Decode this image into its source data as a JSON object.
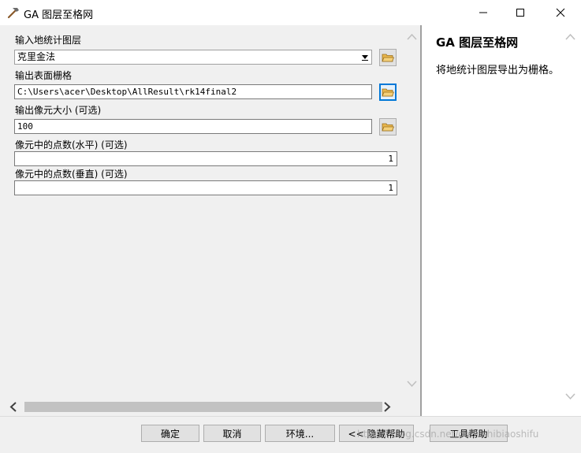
{
  "window": {
    "title": "GA 图层至格网"
  },
  "form": {
    "input_layer": {
      "label": "输入地统计图层",
      "value": "克里金法"
    },
    "output_raster": {
      "label": "输出表面栅格",
      "value": "C:\\Users\\acer\\Desktop\\AllResult\\rk14final2"
    },
    "cell_size": {
      "label": "输出像元大小 (可选)",
      "value": "100"
    },
    "points_horizontal": {
      "label": "像元中的点数(水平) (可选)",
      "value": "1"
    },
    "points_vertical": {
      "label": "像元中的点数(垂直) (可选)",
      "value": "1"
    }
  },
  "help": {
    "title": "GA 图层至格网",
    "text": "将地统计图层导出为栅格。"
  },
  "buttons": {
    "ok": "确定",
    "cancel": "取消",
    "environments": "环境...",
    "hide_help": "<< 隐藏帮助",
    "tool_help": "工具帮助"
  },
  "watermark": "https://blog.csdn.net/dabushibiaoshifu",
  "colors": {
    "accent": "#0078d7",
    "field_border": "#7a7a7a",
    "button_face": "#e1e1e1"
  }
}
